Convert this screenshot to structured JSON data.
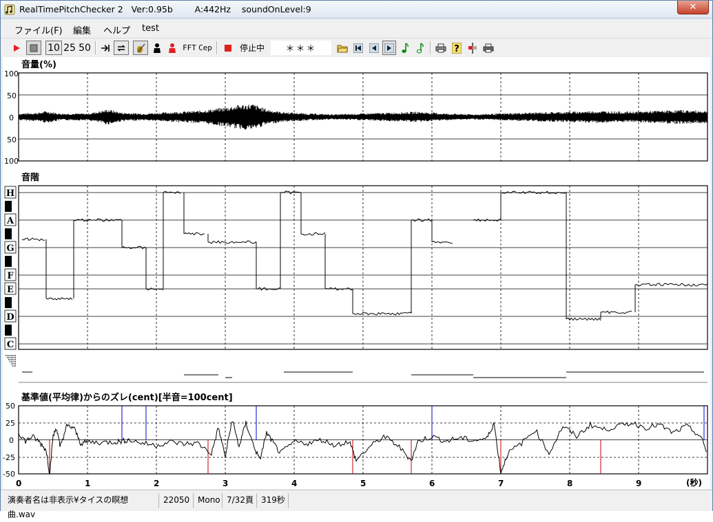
{
  "window": {
    "title": "RealTimePitchChecker 2   Ver:0.95b        A:442Hz    soundOnLevel:9",
    "close_glyph": "✕"
  },
  "menu": [
    "ファイル(F)",
    "編集",
    "ヘルプ",
    "test"
  ],
  "toolbar": {
    "btn_10": "10",
    "btn_25": "25",
    "btn_50": "50",
    "fft_label": "FFT",
    "cep_label": "Cep",
    "status_text": "停止中",
    "note_display": "＊＊＊"
  },
  "volume_panel": {
    "title": "音量(%)",
    "y_ticks": [
      "100",
      "50",
      "0",
      "50",
      "100"
    ]
  },
  "scale_panel": {
    "title": "音階",
    "notes": [
      "H",
      "A",
      "G",
      "F",
      "E",
      "D",
      "C"
    ]
  },
  "cent_panel": {
    "title": "基準値(平均律)からのズレ(cent)[半音=100cent]",
    "y_ticks": [
      "50",
      "25",
      "0",
      "-25",
      "-50"
    ],
    "x_ticks": [
      "0",
      "1",
      "2",
      "3",
      "4",
      "5",
      "6",
      "7",
      "8",
      "9"
    ],
    "x_unit": "(秒)"
  },
  "statusbar": {
    "file": "演奏者名は非表示¥タイスの瞑想曲.wav",
    "rate": "22050",
    "channels": "Mono",
    "page": "7/32頁",
    "duration": "319秒"
  },
  "chart_data": [
    {
      "type": "line",
      "title": "音量(%)",
      "ylim": [
        -100,
        100
      ],
      "xlim": [
        0,
        10
      ],
      "xlabel": "(秒)",
      "note": "waveform amplitude",
      "envelope": [
        [
          0,
          8
        ],
        [
          0.3,
          10
        ],
        [
          0.4,
          14
        ],
        [
          0.6,
          8
        ],
        [
          1.0,
          8
        ],
        [
          1.2,
          14
        ],
        [
          1.3,
          18
        ],
        [
          1.5,
          10
        ],
        [
          1.8,
          8
        ],
        [
          2.3,
          12
        ],
        [
          2.6,
          14
        ],
        [
          2.8,
          18
        ],
        [
          3.0,
          22
        ],
        [
          3.2,
          28
        ],
        [
          3.4,
          30
        ],
        [
          3.6,
          18
        ],
        [
          3.8,
          12
        ],
        [
          4.2,
          8
        ],
        [
          4.6,
          6
        ],
        [
          5.0,
          8
        ],
        [
          5.4,
          10
        ],
        [
          5.8,
          12
        ],
        [
          6.2,
          8
        ],
        [
          6.6,
          6
        ],
        [
          7.0,
          8
        ],
        [
          7.4,
          10
        ],
        [
          8.0,
          12
        ],
        [
          8.4,
          14
        ],
        [
          8.8,
          12
        ],
        [
          9.2,
          14
        ],
        [
          9.6,
          16
        ],
        [
          10.0,
          14
        ]
      ]
    },
    {
      "type": "line",
      "title": "音階",
      "y_notes": [
        "H",
        "A",
        "G",
        "F",
        "E",
        "D",
        "C"
      ],
      "segments": [
        {
          "x": [
            0.05,
            0.38
          ],
          "note": 5.3
        },
        {
          "x": [
            0.4,
            0.78
          ],
          "note": 3.3
        },
        {
          "x": [
            0.8,
            1.5
          ],
          "note": 6.0
        },
        {
          "x": [
            1.5,
            1.85
          ],
          "note": 5.0
        },
        {
          "x": [
            1.85,
            2.1
          ],
          "note": 4.0
        },
        {
          "x": [
            2.1,
            2.35
          ],
          "note": 7.0
        },
        {
          "x": [
            2.4,
            2.7
          ],
          "note": 5.5
        },
        {
          "x": [
            2.75,
            3.45
          ],
          "note": 5.2
        },
        {
          "x": [
            3.45,
            3.8
          ],
          "note": 4.0
        },
        {
          "x": [
            3.8,
            4.1
          ],
          "note": 7.0
        },
        {
          "x": [
            4.1,
            4.45
          ],
          "note": 5.5
        },
        {
          "x": [
            4.45,
            4.85
          ],
          "note": 4.0
        },
        {
          "x": [
            4.85,
            5.7
          ],
          "note": 2.2
        },
        {
          "x": [
            5.7,
            6.0
          ],
          "note": 6.0
        },
        {
          "x": [
            6.0,
            6.3
          ],
          "note": 5.2
        },
        {
          "x": [
            6.6,
            7.0
          ],
          "note": 6.0
        },
        {
          "x": [
            7.0,
            7.95
          ],
          "note": 7.1
        },
        {
          "x": [
            7.95,
            8.45
          ],
          "note": 1.9
        },
        {
          "x": [
            8.45,
            8.9
          ],
          "note": 2.3
        },
        {
          "x": [
            8.95,
            10.0
          ],
          "note": 4.1
        }
      ]
    },
    {
      "type": "line",
      "title": "基準値(平均律)からのズレ(cent)[半音=100cent]",
      "ylim": [
        -50,
        50
      ],
      "xlim": [
        0,
        10
      ],
      "xlabel": "(秒)",
      "xticks": [
        0,
        1,
        2,
        3,
        4,
        5,
        6,
        7,
        8,
        9
      ],
      "yticks": [
        50,
        25,
        0,
        -25,
        -50
      ],
      "values": [
        [
          0,
          10
        ],
        [
          0.1,
          -2
        ],
        [
          0.2,
          5
        ],
        [
          0.3,
          -3
        ],
        [
          0.4,
          -15
        ],
        [
          0.45,
          -50
        ],
        [
          0.5,
          5
        ],
        [
          0.55,
          18
        ],
        [
          0.6,
          -10
        ],
        [
          0.7,
          20
        ],
        [
          0.8,
          18
        ],
        [
          0.9,
          -5
        ],
        [
          1.0,
          -3
        ],
        [
          1.2,
          -4
        ],
        [
          1.4,
          -3
        ],
        [
          1.5,
          -2
        ],
        [
          1.6,
          0
        ],
        [
          1.8,
          -5
        ],
        [
          2.0,
          -8
        ],
        [
          2.2,
          -3
        ],
        [
          2.4,
          -6
        ],
        [
          2.6,
          -5
        ],
        [
          2.8,
          -20
        ],
        [
          2.9,
          18
        ],
        [
          3.0,
          -25
        ],
        [
          3.1,
          30
        ],
        [
          3.2,
          -10
        ],
        [
          3.3,
          25
        ],
        [
          3.4,
          -5
        ],
        [
          3.5,
          -30
        ],
        [
          3.6,
          10
        ],
        [
          3.7,
          -5
        ],
        [
          3.8,
          -20
        ],
        [
          4.0,
          -3
        ],
        [
          4.2,
          -5
        ],
        [
          4.4,
          0
        ],
        [
          4.6,
          -8
        ],
        [
          4.8,
          -2
        ],
        [
          4.9,
          -30
        ],
        [
          5.1,
          -10
        ],
        [
          5.3,
          5
        ],
        [
          5.5,
          -8
        ],
        [
          5.7,
          -30
        ],
        [
          5.8,
          -2
        ],
        [
          6.0,
          5
        ],
        [
          6.2,
          -2
        ],
        [
          6.4,
          3
        ],
        [
          6.6,
          -1
        ],
        [
          6.8,
          2
        ],
        [
          6.9,
          25
        ],
        [
          7.0,
          -48
        ],
        [
          7.1,
          -20
        ],
        [
          7.3,
          -5
        ],
        [
          7.5,
          15
        ],
        [
          7.7,
          -20
        ],
        [
          7.9,
          20
        ],
        [
          8.1,
          5
        ],
        [
          8.3,
          22
        ],
        [
          8.5,
          15
        ],
        [
          8.7,
          20
        ],
        [
          8.9,
          25
        ],
        [
          9.1,
          18
        ],
        [
          9.3,
          22
        ],
        [
          9.5,
          10
        ],
        [
          9.7,
          20
        ],
        [
          9.9,
          5
        ],
        [
          10.0,
          -20
        ]
      ]
    }
  ]
}
